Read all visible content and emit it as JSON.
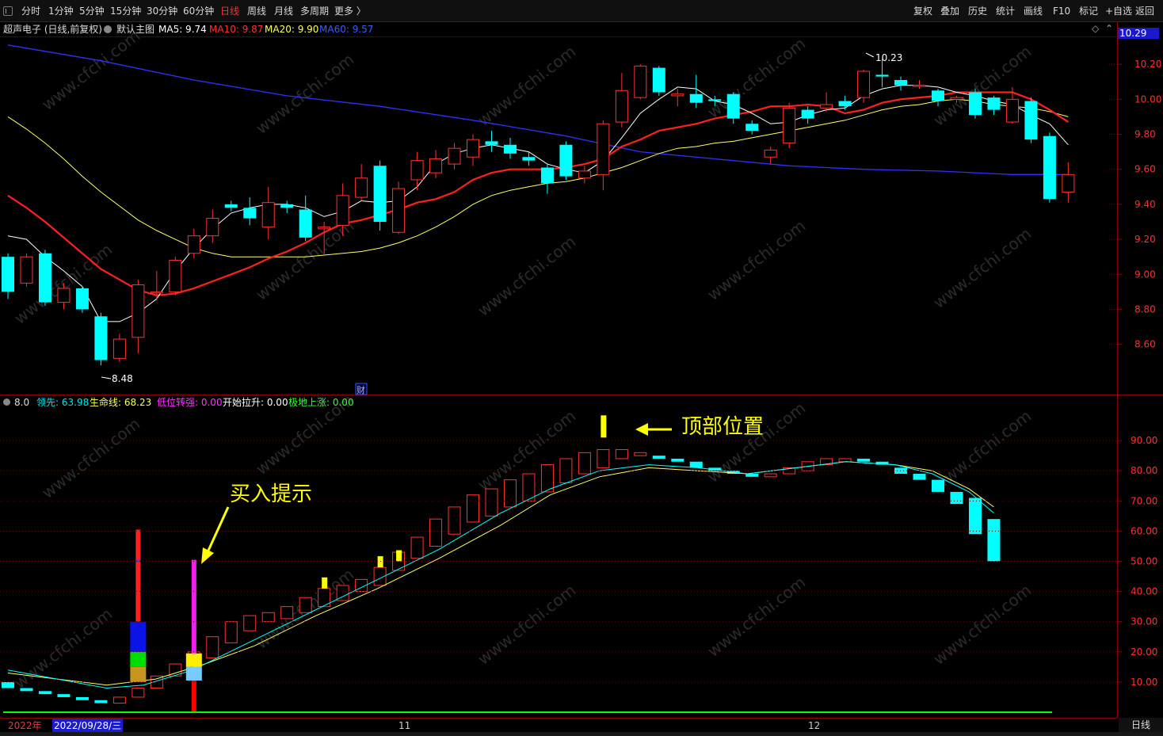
{
  "toolbar": {
    "left": [
      "分时",
      "1分钟",
      "5分钟",
      "15分钟",
      "30分钟",
      "60分钟",
      "日线",
      "周线",
      "月线",
      "多周期",
      "更多 〉"
    ],
    "active_index": 6,
    "right": [
      "复权",
      "叠加",
      "历史",
      "统计",
      "画线",
      "F10",
      "标记",
      "+自选",
      "返回"
    ]
  },
  "main_header": {
    "stock": "超声电子 (日线,前复权)",
    "chart_name": "默认主图",
    "ma5": "MA5: 9.74",
    "ma10": "MA10: 9.87",
    "ma20": "MA20: 9.90",
    "ma60": "MA60: 9.57"
  },
  "ind_header": {
    "param": "8.0",
    "lead": "领先: 63.98",
    "life": "生命线: 68.23",
    "low": "低位转强: 0.00",
    "start": "开始拉升: 0.00",
    "bottom": "极地上涨: 0.00"
  },
  "main_axis": {
    "current": "10.29",
    "ticks": [
      "10.20",
      "10.00",
      "9.80",
      "9.60",
      "9.40",
      "9.20",
      "9.00",
      "8.80",
      "8.60"
    ]
  },
  "ind_axis": {
    "ticks": [
      "90.00",
      "80.00",
      "70.00",
      "60.00",
      "50.00",
      "40.00",
      "30.00",
      "20.00",
      "10.00"
    ]
  },
  "annotations": {
    "high": "10.23",
    "low": "8.48",
    "finance_marker": "财",
    "top_position": "顶部位置",
    "buy_signal": "买入提示"
  },
  "date_bar": {
    "year": "2022年",
    "cursor_date": "2022/09/28/三",
    "month_nov": "11",
    "month_dec": "12"
  },
  "bottom_tab": "日线",
  "colors": {
    "up": "#ff3232",
    "down": "#00ffff",
    "ma5": "#ffffff",
    "ma10": "#ff2020",
    "ma20": "#ffff66",
    "ma60": "#3030ff",
    "lead": "#00ffff",
    "life": "#ffff66",
    "low": "#ff00ff",
    "start": "#ffffff",
    "bottom": "#00ff00"
  },
  "chart_data": {
    "type": "candlestick",
    "price_scale": {
      "max": 10.35,
      "min": 8.44
    },
    "indicator_scale": {
      "max": 100,
      "min": 0
    },
    "candles": [
      [
        9.1,
        8.9,
        9.12,
        8.86
      ],
      [
        8.95,
        9.1,
        9.12,
        8.93
      ],
      [
        9.12,
        8.84,
        9.14,
        8.82
      ],
      [
        8.84,
        8.92,
        8.95,
        8.8
      ],
      [
        8.92,
        8.8,
        8.93,
        8.78
      ],
      [
        8.76,
        8.51,
        8.78,
        8.48
      ],
      [
        8.52,
        8.63,
        8.66,
        8.5
      ],
      [
        8.64,
        8.94,
        8.97,
        8.55
      ],
      [
        8.9,
        8.9,
        9.02,
        8.85
      ],
      [
        8.9,
        9.08,
        9.1,
        8.88
      ],
      [
        9.12,
        9.22,
        9.26,
        9.09
      ],
      [
        9.22,
        9.32,
        9.37,
        9.18
      ],
      [
        9.4,
        9.38,
        9.42,
        9.36
      ],
      [
        9.38,
        9.32,
        9.44,
        9.28
      ],
      [
        9.27,
        9.41,
        9.5,
        9.2
      ],
      [
        9.4,
        9.38,
        9.42,
        9.35
      ],
      [
        9.37,
        9.21,
        9.45,
        9.19
      ],
      [
        9.26,
        9.27,
        9.3,
        9.11
      ],
      [
        9.28,
        9.45,
        9.52,
        9.22
      ],
      [
        9.44,
        9.55,
        9.63,
        9.42
      ],
      [
        9.62,
        9.3,
        9.65,
        9.25
      ],
      [
        9.24,
        9.49,
        9.53,
        9.23
      ],
      [
        9.54,
        9.65,
        9.7,
        9.48
      ],
      [
        9.58,
        9.66,
        9.71,
        9.55
      ],
      [
        9.63,
        9.72,
        9.75,
        9.6
      ],
      [
        9.67,
        9.77,
        9.8,
        9.62
      ],
      [
        9.76,
        9.74,
        9.82,
        9.7
      ],
      [
        9.74,
        9.69,
        9.78,
        9.66
      ],
      [
        9.67,
        9.65,
        9.7,
        9.62
      ],
      [
        9.61,
        9.52,
        9.63,
        9.46
      ],
      [
        9.74,
        9.56,
        9.76,
        9.54
      ],
      [
        9.55,
        9.59,
        9.62,
        9.52
      ],
      [
        9.57,
        9.86,
        9.88,
        9.48
      ],
      [
        9.87,
        10.05,
        10.15,
        9.84
      ],
      [
        10.01,
        10.19,
        10.2,
        10.0
      ],
      [
        10.18,
        10.04,
        10.19,
        10.02
      ],
      [
        10.02,
        10.03,
        10.06,
        9.96
      ],
      [
        10.03,
        9.98,
        10.14,
        9.95
      ],
      [
        10.0,
        9.99,
        10.02,
        9.96
      ],
      [
        10.03,
        9.89,
        10.04,
        9.86
      ],
      [
        9.86,
        9.82,
        9.88,
        9.8
      ],
      [
        9.67,
        9.71,
        9.73,
        9.63
      ],
      [
        9.75,
        9.95,
        9.98,
        9.72
      ],
      [
        9.94,
        9.89,
        9.96,
        9.86
      ],
      [
        9.95,
        9.97,
        10.04,
        9.93
      ],
      [
        9.99,
        9.96,
        10.02,
        9.94
      ],
      [
        10.01,
        10.16,
        10.17,
        9.98
      ],
      [
        10.14,
        10.13,
        10.23,
        10.07
      ],
      [
        10.11,
        10.08,
        10.13,
        10.05
      ],
      [
        10.08,
        10.08,
        10.11,
        10.06
      ],
      [
        10.05,
        9.99,
        10.06,
        9.96
      ],
      [
        10.0,
        10.01,
        10.02,
        9.98
      ],
      [
        10.04,
        9.91,
        10.06,
        9.89
      ],
      [
        10.01,
        9.94,
        10.02,
        9.91
      ],
      [
        9.87,
        10.0,
        10.07,
        9.86
      ],
      [
        9.99,
        9.77,
        10.01,
        9.75
      ],
      [
        9.79,
        9.43,
        9.81,
        9.41
      ],
      [
        9.47,
        9.57,
        9.64,
        9.41
      ]
    ],
    "ma5": [
      [
        0,
        9.22
      ],
      [
        1,
        9.2
      ],
      [
        2,
        9.1
      ],
      [
        3,
        9.02
      ],
      [
        4,
        8.93
      ],
      [
        5,
        8.73
      ],
      [
        6,
        8.73
      ],
      [
        7,
        8.78
      ],
      [
        8,
        8.86
      ],
      [
        9,
        9.02
      ],
      [
        10,
        9.15
      ],
      [
        11,
        9.26
      ],
      [
        12,
        9.35
      ],
      [
        13,
        9.38
      ],
      [
        14,
        9.4
      ],
      [
        15,
        9.4
      ],
      [
        16,
        9.38
      ],
      [
        17,
        9.33
      ],
      [
        18,
        9.36
      ],
      [
        19,
        9.42
      ],
      [
        20,
        9.41
      ],
      [
        21,
        9.42
      ],
      [
        22,
        9.5
      ],
      [
        23,
        9.63
      ],
      [
        24,
        9.69
      ],
      [
        25,
        9.72
      ],
      [
        26,
        9.74
      ],
      [
        27,
        9.72
      ],
      [
        28,
        9.7
      ],
      [
        29,
        9.63
      ],
      [
        30,
        9.6
      ],
      [
        31,
        9.58
      ],
      [
        32,
        9.65
      ],
      [
        33,
        9.78
      ],
      [
        34,
        9.92
      ],
      [
        35,
        10.0
      ],
      [
        36,
        10.07
      ],
      [
        37,
        10.06
      ],
      [
        38,
        9.99
      ],
      [
        39,
        9.97
      ],
      [
        40,
        9.92
      ],
      [
        41,
        9.86
      ],
      [
        42,
        9.87
      ],
      [
        43,
        9.91
      ],
      [
        44,
        9.94
      ],
      [
        45,
        9.95
      ],
      [
        46,
        10.02
      ],
      [
        47,
        10.06
      ],
      [
        48,
        10.08
      ],
      [
        49,
        10.08
      ],
      [
        50,
        10.07
      ],
      [
        51,
        10.04
      ],
      [
        52,
        10.02
      ],
      [
        53,
        9.99
      ],
      [
        54,
        9.97
      ],
      [
        55,
        9.91
      ],
      [
        56,
        9.86
      ],
      [
        57,
        9.74
      ]
    ],
    "ma10": [
      [
        0,
        9.45
      ],
      [
        1,
        9.38
      ],
      [
        2,
        9.3
      ],
      [
        3,
        9.21
      ],
      [
        4,
        9.12
      ],
      [
        5,
        9.03
      ],
      [
        6,
        8.97
      ],
      [
        7,
        8.91
      ],
      [
        8,
        8.88
      ],
      [
        9,
        8.89
      ],
      [
        10,
        8.92
      ],
      [
        11,
        8.96
      ],
      [
        12,
        9.0
      ],
      [
        13,
        9.04
      ],
      [
        14,
        9.09
      ],
      [
        15,
        9.13
      ],
      [
        16,
        9.18
      ],
      [
        17,
        9.24
      ],
      [
        18,
        9.29
      ],
      [
        19,
        9.31
      ],
      [
        20,
        9.34
      ],
      [
        21,
        9.37
      ],
      [
        22,
        9.41
      ],
      [
        23,
        9.43
      ],
      [
        24,
        9.47
      ],
      [
        25,
        9.54
      ],
      [
        26,
        9.58
      ],
      [
        27,
        9.6
      ],
      [
        28,
        9.6
      ],
      [
        29,
        9.6
      ],
      [
        30,
        9.61
      ],
      [
        31,
        9.63
      ],
      [
        32,
        9.66
      ],
      [
        33,
        9.73
      ],
      [
        34,
        9.77
      ],
      [
        35,
        9.82
      ],
      [
        36,
        9.84
      ],
      [
        37,
        9.86
      ],
      [
        38,
        9.89
      ],
      [
        39,
        9.91
      ],
      [
        40,
        9.93
      ],
      [
        41,
        9.96
      ],
      [
        42,
        9.96
      ],
      [
        43,
        9.97
      ],
      [
        44,
        9.96
      ],
      [
        45,
        9.92
      ],
      [
        46,
        9.94
      ],
      [
        47,
        9.98
      ],
      [
        48,
        10.0
      ],
      [
        49,
        10.01
      ],
      [
        50,
        10.02
      ],
      [
        51,
        10.04
      ],
      [
        52,
        10.04
      ],
      [
        53,
        10.04
      ],
      [
        54,
        10.04
      ],
      [
        55,
        10.0
      ],
      [
        56,
        9.94
      ],
      [
        57,
        9.87
      ]
    ],
    "ma20": [
      [
        0,
        9.9
      ],
      [
        1,
        9.83
      ],
      [
        2,
        9.75
      ],
      [
        3,
        9.66
      ],
      [
        4,
        9.56
      ],
      [
        5,
        9.47
      ],
      [
        6,
        9.39
      ],
      [
        7,
        9.31
      ],
      [
        8,
        9.25
      ],
      [
        9,
        9.2
      ],
      [
        10,
        9.15
      ],
      [
        11,
        9.12
      ],
      [
        12,
        9.1
      ],
      [
        13,
        9.1
      ],
      [
        14,
        9.1
      ],
      [
        15,
        9.1
      ],
      [
        16,
        9.1
      ],
      [
        17,
        9.11
      ],
      [
        18,
        9.12
      ],
      [
        19,
        9.13
      ],
      [
        20,
        9.15
      ],
      [
        21,
        9.18
      ],
      [
        22,
        9.22
      ],
      [
        23,
        9.27
      ],
      [
        24,
        9.33
      ],
      [
        25,
        9.4
      ],
      [
        26,
        9.45
      ],
      [
        27,
        9.48
      ],
      [
        28,
        9.5
      ],
      [
        29,
        9.52
      ],
      [
        30,
        9.53
      ],
      [
        31,
        9.55
      ],
      [
        32,
        9.58
      ],
      [
        33,
        9.61
      ],
      [
        34,
        9.65
      ],
      [
        35,
        9.69
      ],
      [
        36,
        9.72
      ],
      [
        37,
        9.73
      ],
      [
        38,
        9.75
      ],
      [
        39,
        9.76
      ],
      [
        40,
        9.78
      ],
      [
        41,
        9.8
      ],
      [
        42,
        9.82
      ],
      [
        43,
        9.84
      ],
      [
        44,
        9.86
      ],
      [
        45,
        9.88
      ],
      [
        46,
        9.91
      ],
      [
        47,
        9.94
      ],
      [
        48,
        9.96
      ],
      [
        49,
        9.97
      ],
      [
        50,
        9.99
      ],
      [
        51,
        10.0
      ],
      [
        52,
        9.99
      ],
      [
        53,
        9.97
      ],
      [
        54,
        9.96
      ],
      [
        55,
        9.95
      ],
      [
        56,
        9.93
      ],
      [
        57,
        9.9
      ]
    ],
    "ma60": [
      [
        0,
        10.31
      ],
      [
        5,
        10.22
      ],
      [
        10,
        10.11
      ],
      [
        15,
        10.02
      ],
      [
        20,
        9.96
      ],
      [
        25,
        9.88
      ],
      [
        30,
        9.79
      ],
      [
        34,
        9.7
      ],
      [
        38,
        9.66
      ],
      [
        42,
        9.62
      ],
      [
        46,
        9.6
      ],
      [
        50,
        9.59
      ],
      [
        54,
        9.57
      ],
      [
        57,
        9.57
      ]
    ],
    "ind_candles": [
      [
        10,
        8
      ],
      [
        8,
        7
      ],
      [
        7,
        6
      ],
      [
        6,
        5
      ],
      [
        5,
        4
      ],
      [
        4,
        3
      ],
      [
        3,
        5
      ],
      [
        5,
        8
      ],
      [
        8,
        12
      ],
      [
        12,
        16
      ],
      [
        14,
        20
      ],
      [
        18,
        25
      ],
      [
        23,
        30
      ],
      [
        27,
        32
      ],
      [
        30,
        33
      ],
      [
        31,
        35
      ],
      [
        33,
        38
      ],
      [
        35,
        41
      ],
      [
        37,
        42
      ],
      [
        40,
        44
      ],
      [
        42,
        48
      ],
      [
        47,
        53
      ],
      [
        51,
        58
      ],
      [
        55,
        64
      ],
      [
        59,
        68
      ],
      [
        63,
        72
      ],
      [
        65,
        74
      ],
      [
        68,
        77
      ],
      [
        70,
        79
      ],
      [
        73,
        82
      ],
      [
        76,
        84
      ],
      [
        79,
        86
      ],
      [
        81,
        87
      ],
      [
        84,
        87
      ],
      [
        85,
        86
      ],
      [
        85,
        84
      ],
      [
        84,
        83
      ],
      [
        83,
        81
      ],
      [
        81,
        80
      ],
      [
        80,
        79
      ],
      [
        79,
        78
      ],
      [
        78,
        79
      ],
      [
        79,
        81
      ],
      [
        80,
        83
      ],
      [
        82,
        84
      ],
      [
        83,
        84
      ],
      [
        84,
        83
      ],
      [
        83,
        82
      ],
      [
        81,
        79
      ],
      [
        79,
        77
      ],
      [
        77,
        73
      ],
      [
        73,
        69
      ],
      [
        71,
        59
      ],
      [
        64,
        50
      ]
    ],
    "lead": [
      [
        0,
        14
      ],
      [
        4,
        11
      ],
      [
        8,
        8
      ],
      [
        11,
        9
      ],
      [
        15,
        14
      ],
      [
        20,
        24
      ],
      [
        25,
        34
      ],
      [
        30,
        44
      ],
      [
        35,
        54
      ],
      [
        40,
        66
      ],
      [
        44,
        74
      ],
      [
        48,
        80
      ],
      [
        52,
        82
      ],
      [
        56,
        81
      ],
      [
        60,
        79
      ],
      [
        64,
        81
      ],
      [
        68,
        83
      ],
      [
        72,
        82
      ],
      [
        75,
        79
      ],
      [
        78,
        73
      ],
      [
        80,
        66
      ]
    ],
    "life": [
      [
        0,
        13
      ],
      [
        4,
        11
      ],
      [
        8,
        9
      ],
      [
        12,
        11
      ],
      [
        16,
        16
      ],
      [
        20,
        22
      ],
      [
        25,
        32
      ],
      [
        30,
        41
      ],
      [
        35,
        51
      ],
      [
        40,
        62
      ],
      [
        44,
        72
      ],
      [
        48,
        78
      ],
      [
        52,
        81
      ],
      [
        56,
        80
      ],
      [
        60,
        79
      ],
      [
        64,
        81
      ],
      [
        68,
        83
      ],
      [
        72,
        82
      ],
      [
        75,
        80
      ],
      [
        78,
        74
      ],
      [
        80,
        68
      ]
    ],
    "yellow_marks": [
      [
        17,
        41
      ],
      [
        20,
        48
      ],
      [
        21,
        50
      ],
      [
        32,
        91
      ]
    ],
    "signal_bars": [
      {
        "x": 6.8,
        "segs": [
          [
            0,
            10,
            "#ffb000"
          ],
          [
            10,
            20,
            "#ffb000"
          ],
          [
            20,
            30,
            "#0a8a00"
          ],
          [
            30,
            40,
            "#00e000"
          ],
          [
            40,
            50,
            "#0000cc"
          ],
          [
            50,
            60,
            "#ff2020"
          ],
          [
            60,
            51,
            "#ff2020"
          ]
        ]
      },
      {
        "x": 10,
        "segs": [
          [
            0,
            1,
            "#ff0000"
          ]
        ]
      }
    ]
  }
}
